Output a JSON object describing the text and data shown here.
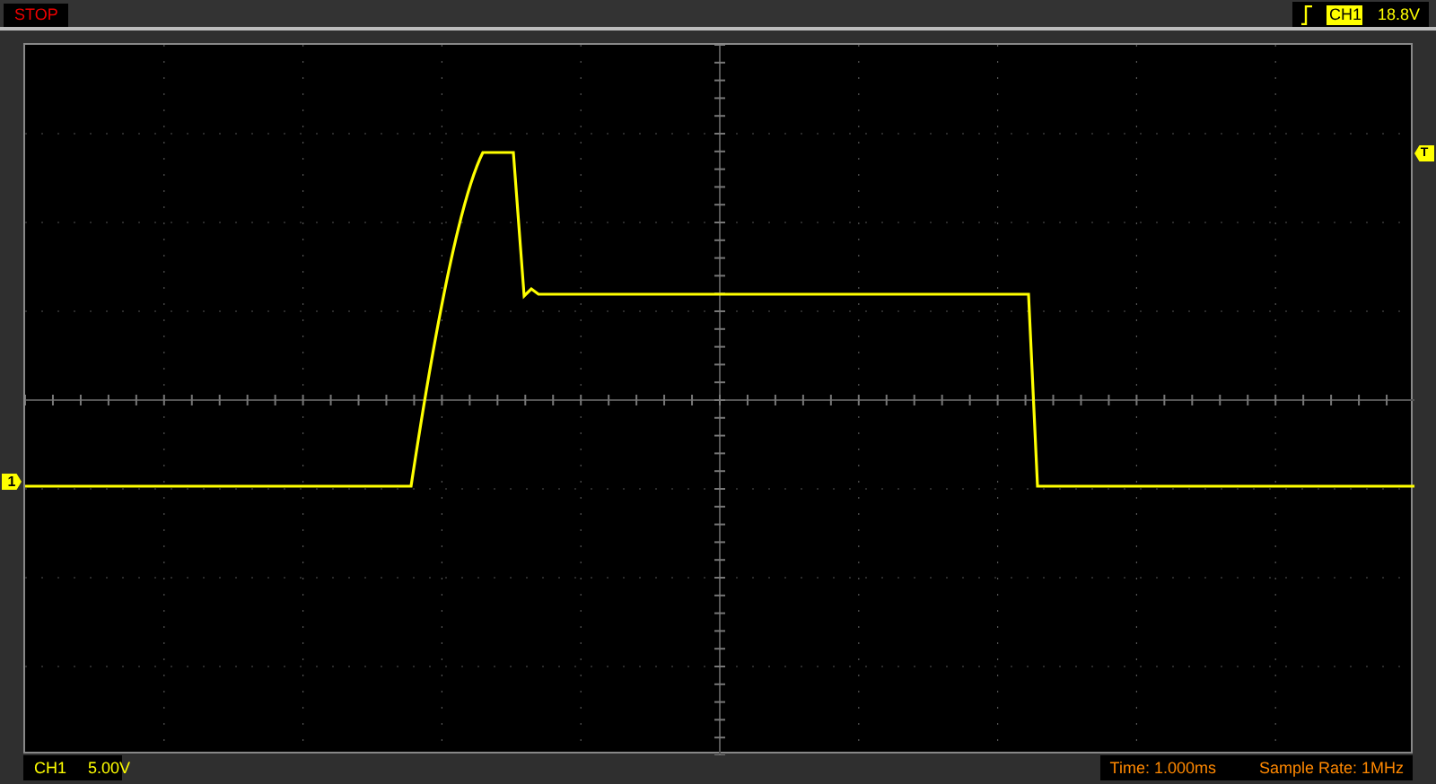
{
  "top_bar": {
    "run_state": "STOP",
    "trigger_channel": "CH1",
    "trigger_level": "18.8V"
  },
  "markers": {
    "channel_marker": "1",
    "trigger_marker": "T"
  },
  "bottom_bar": {
    "channel": "CH1",
    "volts_per_div": "5.00V",
    "time_base": "Time: 1.000ms",
    "sample_rate": "Sample Rate: 1MHz"
  }
}
